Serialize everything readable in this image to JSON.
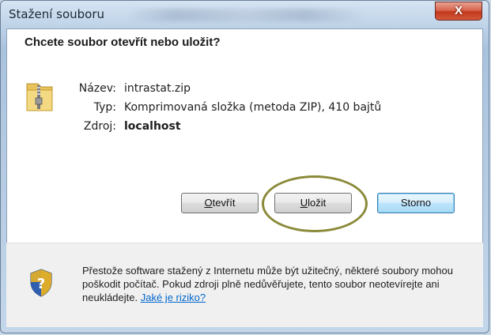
{
  "window": {
    "title": "Stažení souboru",
    "close_label": "X"
  },
  "dialog": {
    "heading": "Chcete soubor otevřít nebo uložit?",
    "fields": [
      {
        "label": "Název:",
        "value": "intrastat.zip"
      },
      {
        "label": "Typ:",
        "value": "Komprimovaná složka (metoda ZIP), 410 bajtů"
      },
      {
        "label": "Zdroj:",
        "value": "localhost"
      }
    ],
    "buttons": {
      "open_first": "O",
      "open_rest": "tevřít",
      "save_first": "U",
      "save_rest": "ložit",
      "cancel": "Storno"
    }
  },
  "warning": {
    "text": "Přestože software stažený z Internetu může být užitečný, některé soubory mohou poškodit počítač. Pokud zdroji plně nedůvěřujete, tento soubor neotevírejte ani neukládejte. ",
    "link": "Jaké je riziko?"
  },
  "colors": {
    "link": "#0066cc",
    "annotation_ellipse": "#8b8a3a",
    "close_button": "#c3381d"
  },
  "icons": {
    "file": "zip-folder-icon",
    "warning": "security-shield-icon"
  }
}
